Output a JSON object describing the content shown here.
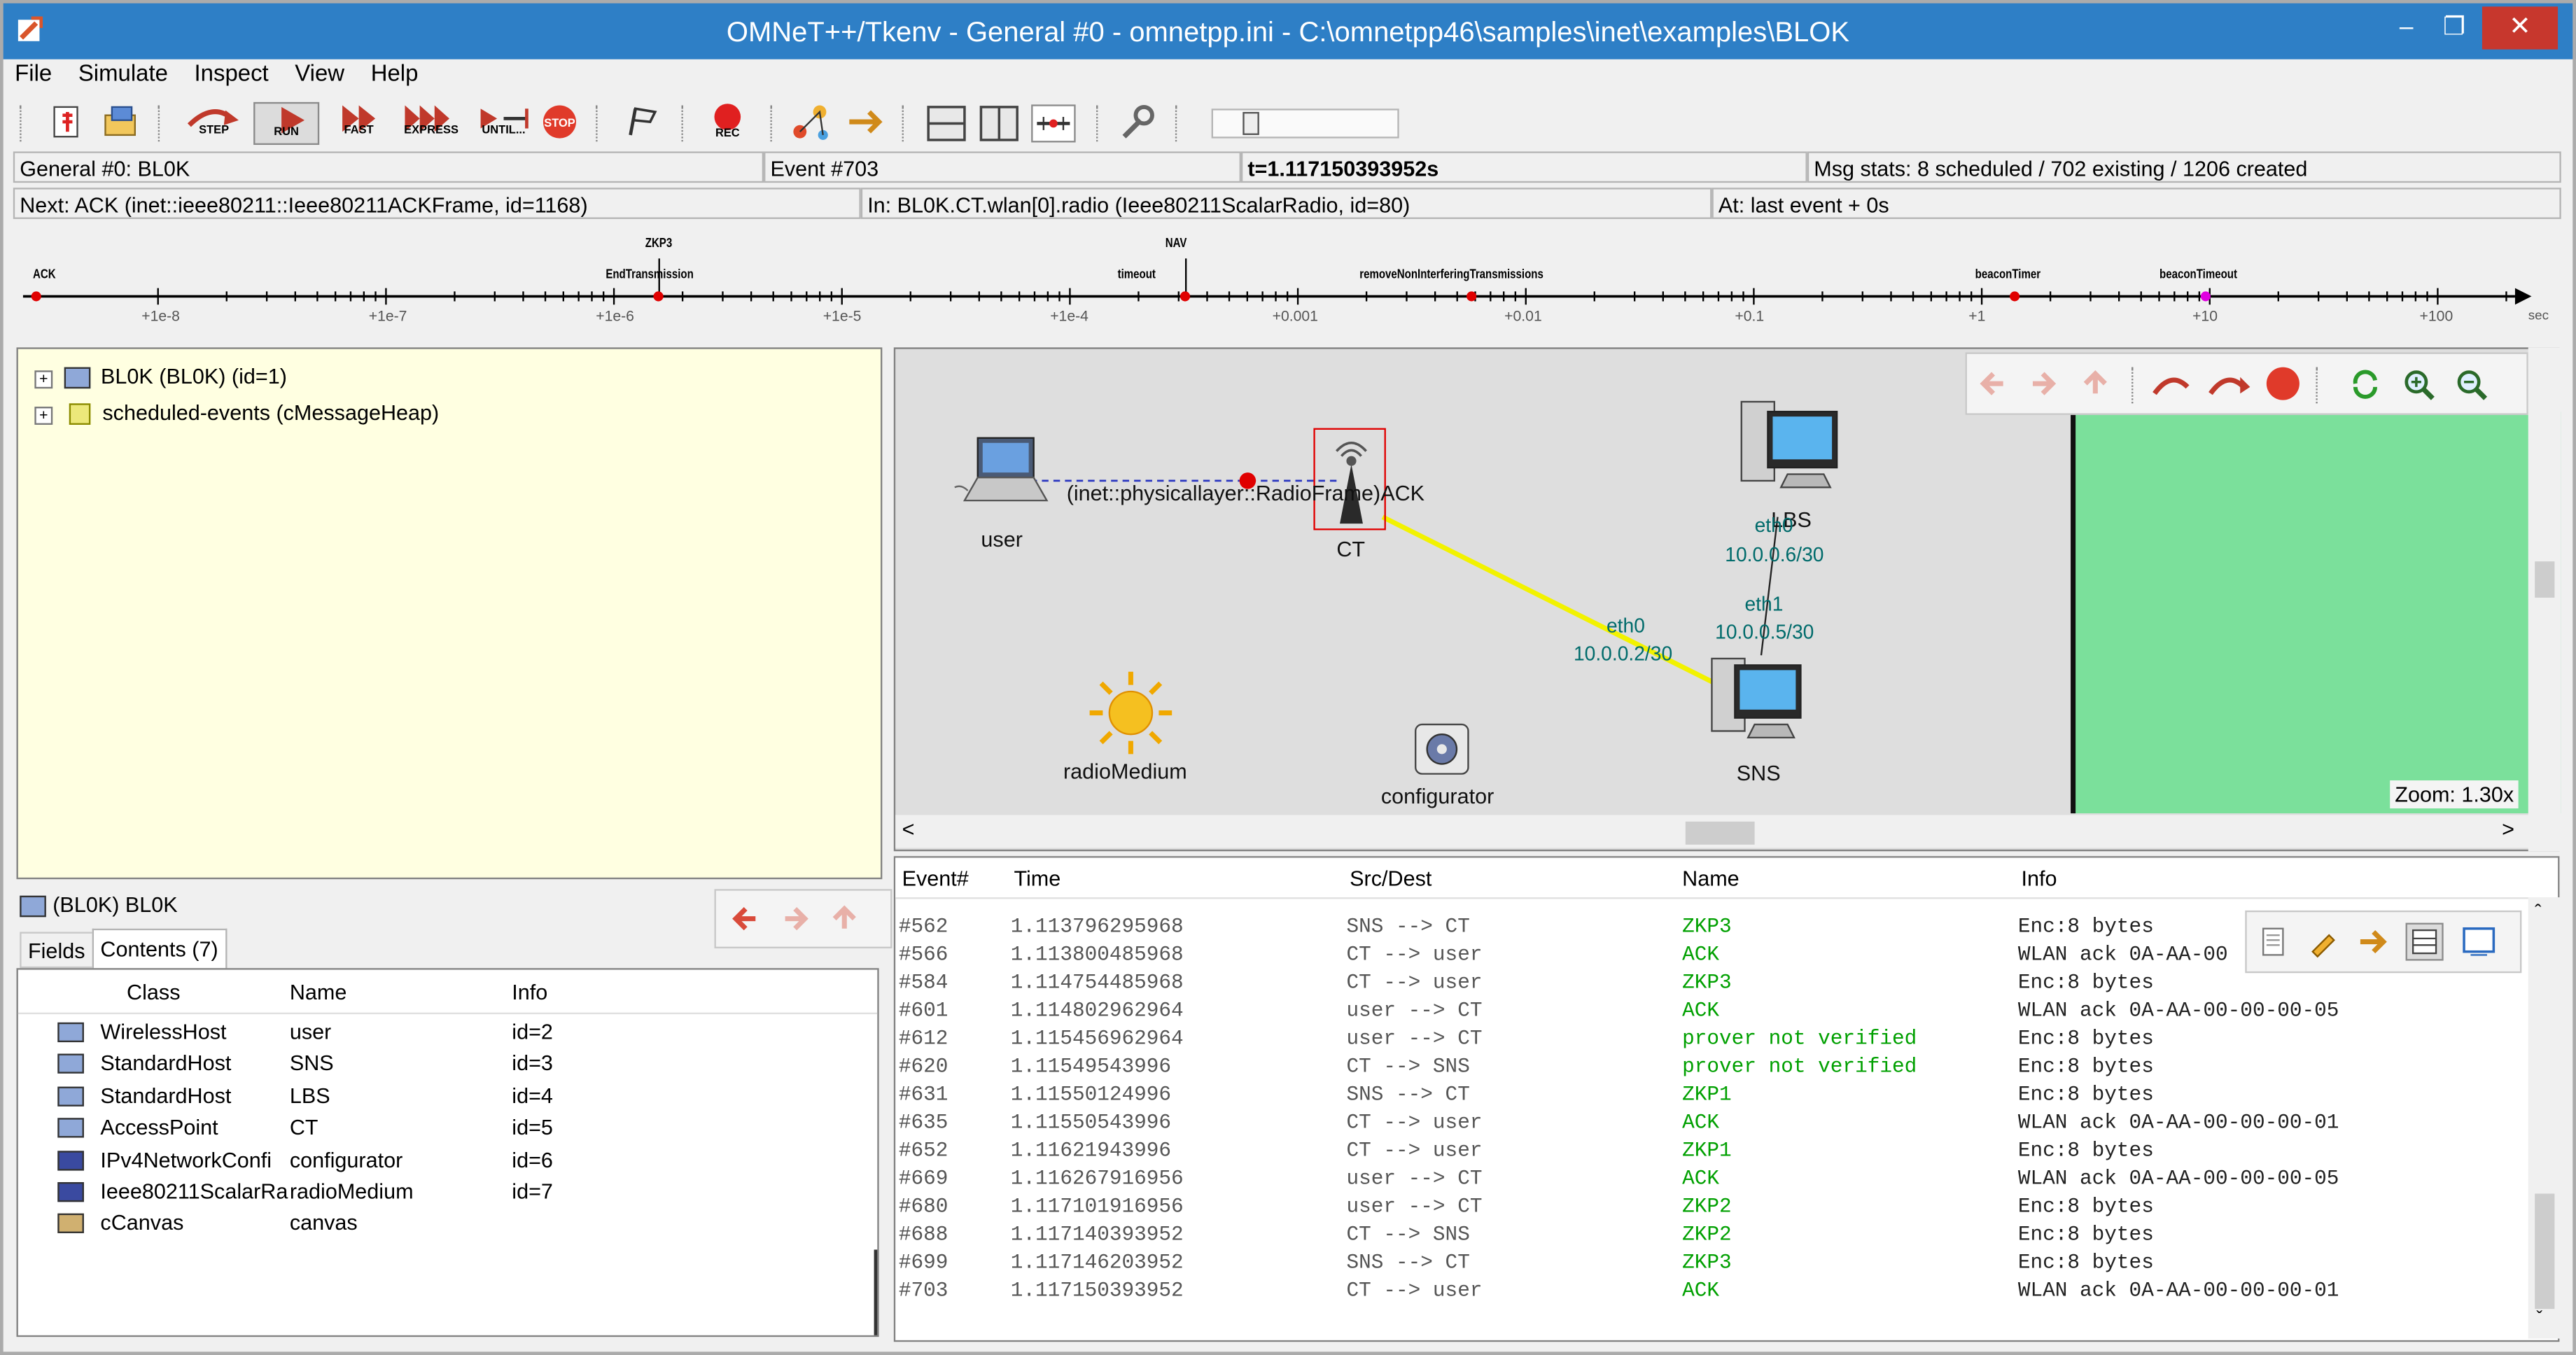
{
  "window": {
    "title": "OMNeT++/Tkenv - General #0 - omnetpp.ini - C:\\omnetpp46\\samples\\inet\\examples\\BLOK",
    "minimize": "–",
    "restore": "❐",
    "close": "✕"
  },
  "menu": [
    "File",
    "Simulate",
    "Inspect",
    "View",
    "Help"
  ],
  "toolbar": {
    "step": "STEP",
    "run": "RUN",
    "fast": "FAST",
    "express": "EXPRESS",
    "until": "UNTIL...",
    "stop": "STOP",
    "rec": "REC"
  },
  "status": {
    "config": "General #0: BL0K",
    "event": "Event #703",
    "time": "t=1.117150393952s",
    "msgstats": "Msg stats: 8 scheduled / 702 existing / 1206 created",
    "next": "Next: ACK (inet::ieee80211::Ieee80211ACKFrame, id=1168)",
    "in": "In: BL0K.CT.wlan[0].radio (Ieee80211ScalarRadio, id=80)",
    "at": "At: last event + 0s"
  },
  "timeline": {
    "events": [
      {
        "label": "ACK",
        "color": "#e00000"
      },
      {
        "label": "ZKP3",
        "color": "#e00000"
      },
      {
        "label": "EndTransmission",
        "color": "#e00000"
      },
      {
        "label": "NAV",
        "color": "#e00000"
      },
      {
        "label": "timeout",
        "color": "#e00000"
      },
      {
        "label": "removeNonInterferingTransmissions",
        "color": "#e00000"
      },
      {
        "label": "beaconTimer",
        "color": "#e00000"
      },
      {
        "label": "beaconTimeout",
        "color": "#e000e0"
      }
    ],
    "ticks": [
      "+1e-8",
      "+1e-7",
      "+1e-6",
      "+1e-5",
      "+1e-4",
      "+0.001",
      "+0.01",
      "+0.1",
      "+1",
      "+10",
      "+100"
    ],
    "unit": "sec"
  },
  "tree": [
    {
      "label": "BL0K (BL0K) (id=1)"
    },
    {
      "label": "scheduled-events (cMessageHeap)"
    }
  ],
  "inspector": {
    "title": "(BL0K) BL0K",
    "tabs": [
      "Fields",
      "Contents (7)"
    ],
    "columns": [
      "Class",
      "Name",
      "Info"
    ],
    "rows": [
      {
        "cls": "WirelessHost",
        "name": "user",
        "info": "id=2"
      },
      {
        "cls": "StandardHost",
        "name": "SNS",
        "info": "id=3"
      },
      {
        "cls": "StandardHost",
        "name": "LBS",
        "info": "id=4"
      },
      {
        "cls": "AccessPoint",
        "name": "CT",
        "info": "id=5"
      },
      {
        "cls": "IPv4NetworkConfi",
        "name": "configurator",
        "info": "id=6"
      },
      {
        "cls": "Ieee80211ScalarRa",
        "name": "radioMedium",
        "info": "id=7"
      },
      {
        "cls": "cCanvas",
        "name": "canvas",
        "info": ""
      }
    ]
  },
  "network": {
    "nodes": {
      "user": "user",
      "ct": "CT",
      "lbs": "LBS",
      "sns": "SNS",
      "radioMedium": "radioMedium",
      "configurator": "configurator"
    },
    "message_label": "(inet::physicallayer::RadioFrame)ACK",
    "ifaces": {
      "lbs_eth0_name": "eth0",
      "lbs_eth0_ip": "10.0.0.6/30",
      "sns_eth1_name": "eth1",
      "sns_eth1_ip": "10.0.0.5/30",
      "ct_eth0_name": "eth0",
      "ct_eth0_ip": "10.0.0.2/30"
    },
    "zoom": "Zoom: 1.30x",
    "colors": {
      "link_ct_sns": "#f2f200",
      "background": "#dedede",
      "right_area": "#7be09b"
    }
  },
  "log": {
    "columns": [
      "Event#",
      "Time",
      "Src/Dest",
      "Name",
      "Info"
    ],
    "rows": [
      {
        "event": "#562",
        "time": "1.113796295968",
        "src": "SNS --> CT",
        "name": "ZKP3",
        "info": "Enc:8 bytes"
      },
      {
        "event": "#566",
        "time": "1.113800485968",
        "src": "CT --> user",
        "name": "ACK",
        "info": "WLAN ack 0A-AA-00"
      },
      {
        "event": "#584",
        "time": "1.114754485968",
        "src": "CT --> user",
        "name": "ZKP3",
        "info": "Enc:8 bytes"
      },
      {
        "event": "#601",
        "time": "1.114802962964",
        "src": "user --> CT",
        "name": "ACK",
        "info": "WLAN ack 0A-AA-00-00-00-05"
      },
      {
        "event": "#612",
        "time": "1.115456962964",
        "src": "user --> CT",
        "name": "prover not verified",
        "info": "Enc:8 bytes"
      },
      {
        "event": "#620",
        "time": "1.11549543996",
        "src": "CT --> SNS",
        "name": "prover not verified",
        "info": "Enc:8 bytes"
      },
      {
        "event": "#631",
        "time": "1.11550124996",
        "src": "SNS --> CT",
        "name": "ZKP1",
        "info": "Enc:8 bytes"
      },
      {
        "event": "#635",
        "time": "1.11550543996",
        "src": "CT --> user",
        "name": "ACK",
        "info": "WLAN ack 0A-AA-00-00-00-01"
      },
      {
        "event": "#652",
        "time": "1.11621943996",
        "src": "CT --> user",
        "name": "ZKP1",
        "info": "Enc:8 bytes"
      },
      {
        "event": "#669",
        "time": "1.116267916956",
        "src": "user --> CT",
        "name": "ACK",
        "info": "WLAN ack 0A-AA-00-00-00-05"
      },
      {
        "event": "#680",
        "time": "1.117101916956",
        "src": "user --> CT",
        "name": "ZKP2",
        "info": "Enc:8 bytes"
      },
      {
        "event": "#688",
        "time": "1.117140393952",
        "src": "CT --> SNS",
        "name": "ZKP2",
        "info": "Enc:8 bytes"
      },
      {
        "event": "#699",
        "time": "1.117146203952",
        "src": "SNS --> CT",
        "name": "ZKP3",
        "info": "Enc:8 bytes"
      },
      {
        "event": "#703",
        "time": "1.117150393952",
        "src": "CT --> user",
        "name": "ACK",
        "info": "WLAN ack 0A-AA-00-00-00-01"
      }
    ]
  }
}
